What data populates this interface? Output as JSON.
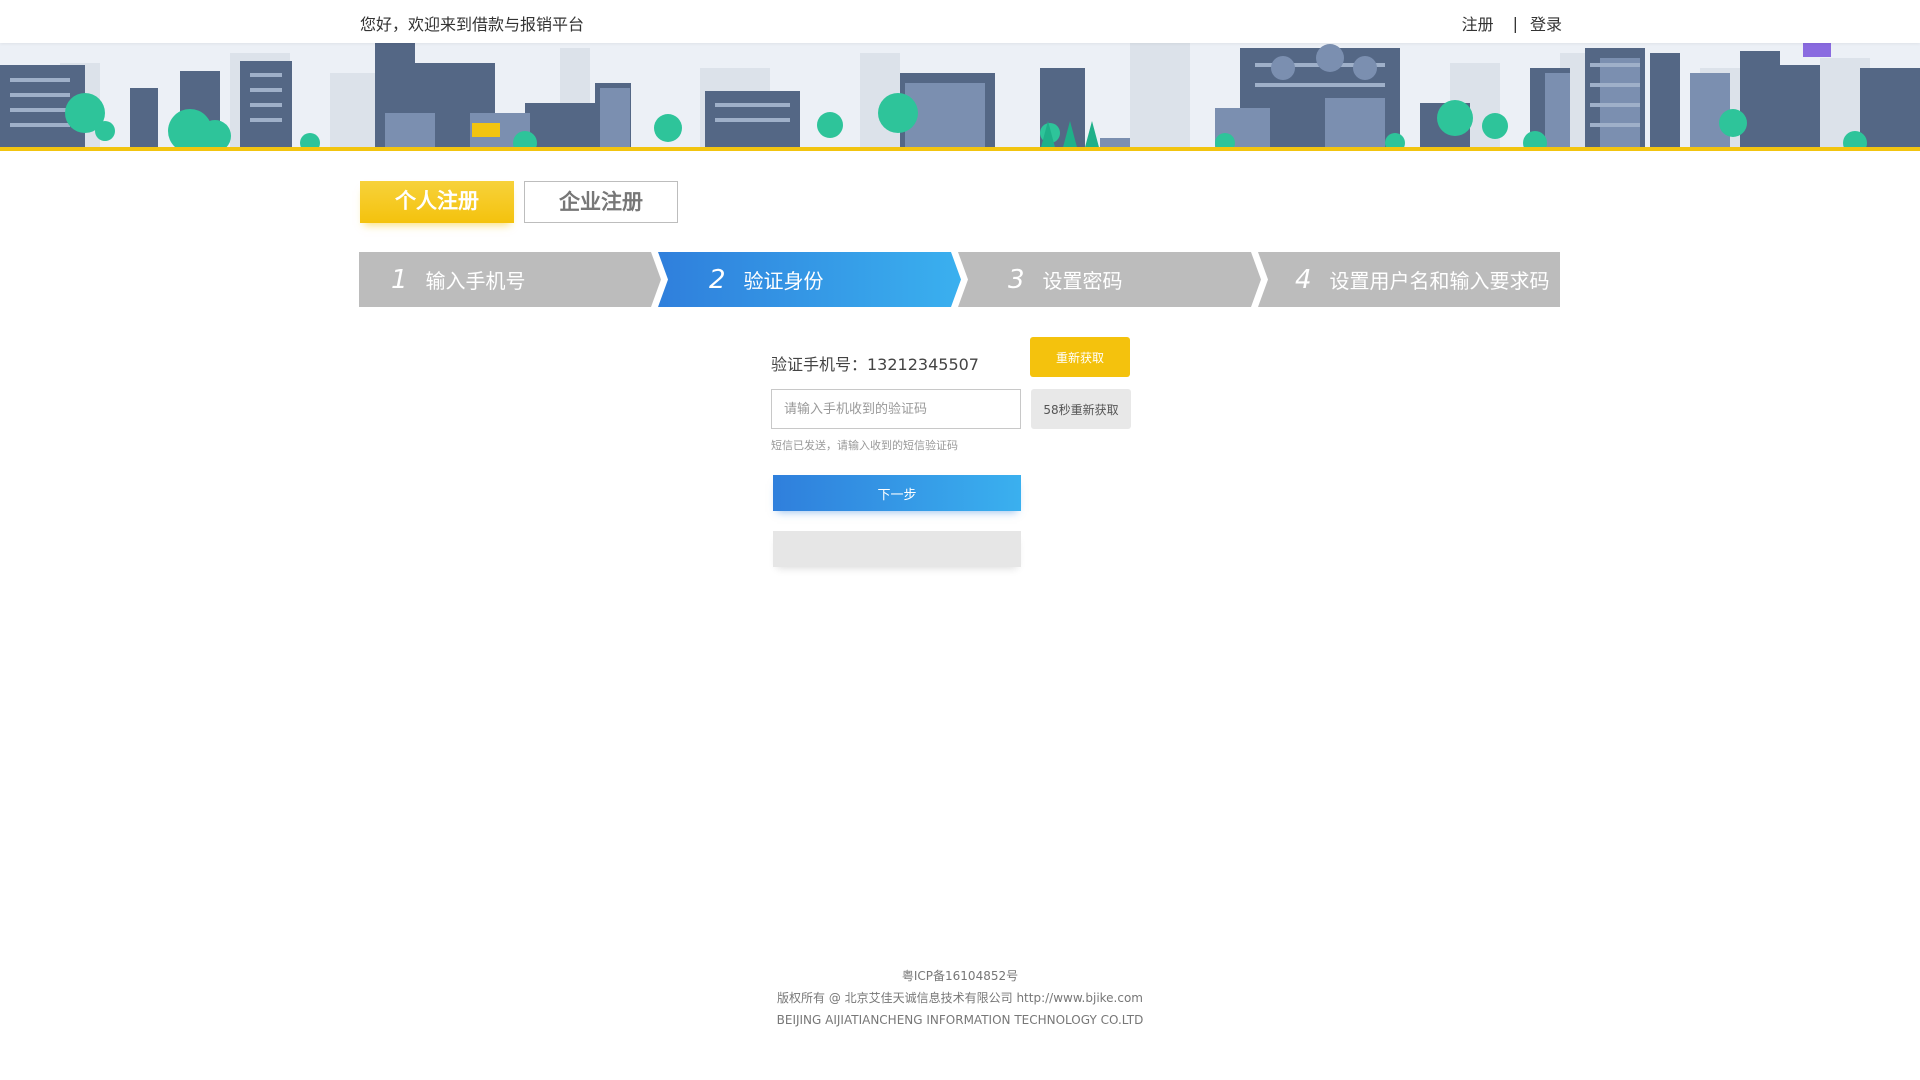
{
  "header": {
    "welcome": "您好，欢迎来到借款与报销平台",
    "register_link": "注册",
    "separator": "|",
    "login_link": "登录"
  },
  "tabs": {
    "personal": "个人注册",
    "company": "企业注册"
  },
  "steps": [
    {
      "num": "1",
      "label": "输入手机号"
    },
    {
      "num": "2",
      "label": "验证身份"
    },
    {
      "num": "3",
      "label": "设置密码"
    },
    {
      "num": "4",
      "label": "设置用户名和输入要求码"
    }
  ],
  "form": {
    "phone_label": "验证手机号：13212345507",
    "refetch_button": "重新获取",
    "code_placeholder": "请输入手机收到的验证码",
    "code_value": "",
    "countdown_button": "58秒重新获取",
    "hint": "短信已发送，请输入收到的短信验证码",
    "next_button": "下一步",
    "secondary_button": ""
  },
  "footer": {
    "icp": "粤ICP备16104852号",
    "copyright": "版权所有 @ 北京艾佳天诚信息技术有限公司 http://www.bjike.com",
    "company_en": "BEIJING AIJIATIANCHENG INFORMATION TECHNOLOGY CO.LTD"
  },
  "colors": {
    "accent_yellow": "#f4c20d",
    "accent_blue": "#2f7fdc",
    "step_inactive": "#bcbcbc"
  }
}
